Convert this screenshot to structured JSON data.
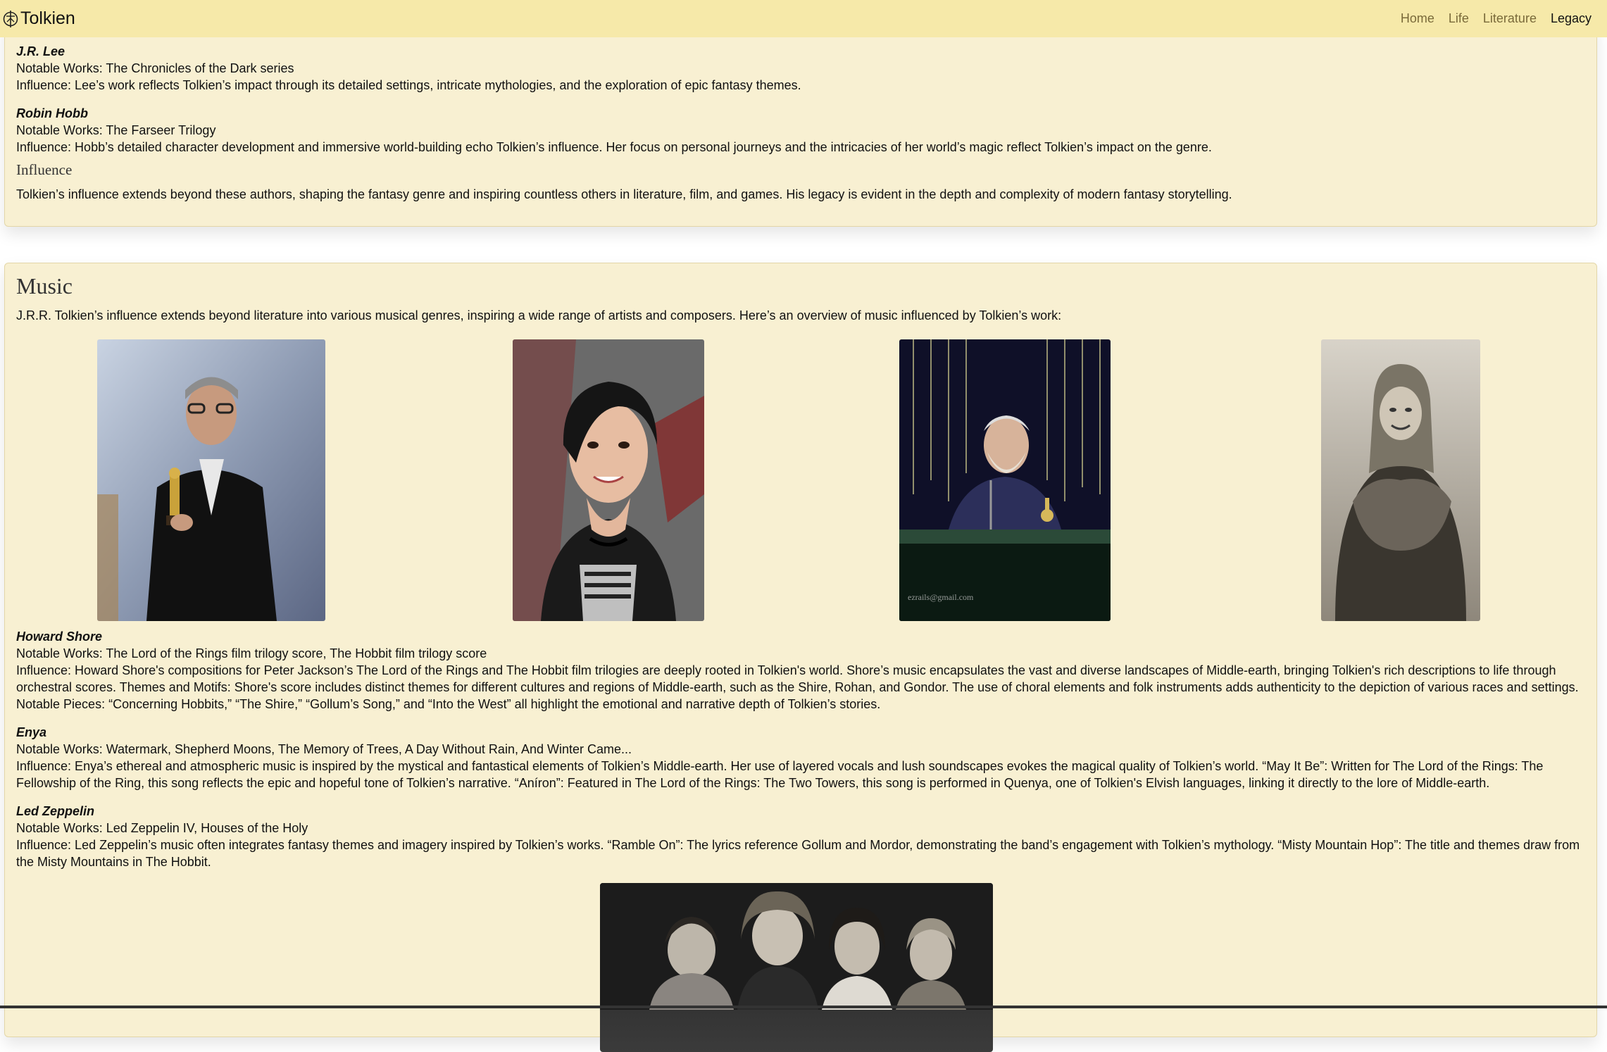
{
  "navbar": {
    "brand": "Tolkien",
    "items": [
      {
        "label": "Home",
        "active": false
      },
      {
        "label": "Life",
        "active": false
      },
      {
        "label": "Literature",
        "active": false
      },
      {
        "label": "Legacy",
        "active": true
      }
    ]
  },
  "authors": [
    {
      "name": "J.R. Lee",
      "works": "Notable Works: The Chronicles of the Dark series",
      "influence": "Influence: Lee’s work reflects Tolkien’s impact through its detailed settings, intricate mythologies, and the exploration of epic fantasy themes."
    },
    {
      "name": "Robin Hobb",
      "works": "Notable Works: The Farseer Trilogy",
      "influence": "Influence: Hobb’s detailed character development and immersive world-building echo Tolkien’s influence. Her focus on personal journeys and the intricacies of her world’s magic reflect Tolkien’s impact on the genre."
    }
  ],
  "influence": {
    "heading": "Influence",
    "text": "Tolkien’s influence extends beyond these authors, shaping the fantasy genre and inspiring countless others in literature, film, and games. His legacy is evident in the depth and complexity of modern fantasy storytelling."
  },
  "music": {
    "title": "Music",
    "intro": "J.R.R. Tolkien’s influence extends beyond literature into various musical genres, inspiring a wide range of artists and composers. Here’s an overview of music influenced by Tolkien’s work:",
    "artists": [
      {
        "name": "Howard Shore",
        "works": "Notable Works: The Lord of the Rings film trilogy score, The Hobbit film trilogy score",
        "influence": "Influence: Howard Shore's compositions for Peter Jackson’s The Lord of the Rings and The Hobbit film trilogies are deeply rooted in Tolkien's world. Shore’s music encapsulates the vast and diverse landscapes of Middle-earth, bringing Tolkien's rich descriptions to life through orchestral scores. Themes and Motifs: Shore's score includes distinct themes for different cultures and regions of Middle-earth, such as the Shire, Rohan, and Gondor. The use of choral elements and folk instruments adds authenticity to the depiction of various races and settings. Notable Pieces: “Concerning Hobbits,” “The Shire,” “Gollum’s Song,” and “Into the West” all highlight the emotional and narrative depth of Tolkien’s stories."
      },
      {
        "name": "Enya",
        "works": "Notable Works: Watermark, Shepherd Moons, The Memory of Trees, A Day Without Rain, And Winter Came...",
        "influence": "Influence: Enya’s ethereal and atmospheric music is inspired by the mystical and fantastical elements of Tolkien’s Middle-earth. Her use of layered vocals and lush soundscapes evokes the magical quality of Tolkien’s world. “May It Be”: Written for The Lord of the Rings: The Fellowship of the Ring, this song reflects the epic and hopeful tone of Tolkien’s narrative. “Aníron”: Featured in The Lord of the Rings: The Two Towers, this song is performed in Quenya, one of Tolkien's Elvish languages, linking it directly to the lore of Middle-earth."
      },
      {
        "name": "Led Zeppelin",
        "works": "Notable Works: Led Zeppelin IV, Houses of the Holy",
        "influence": "Influence: Led Zeppelin’s music often integrates fantasy themes and imagery inspired by Tolkien’s works. “Ramble On”: The lyrics reference Gollum and Mordor, demonstrating the band’s engagement with Tolkien’s mythology. “Misty Mountain Hop”: The title and themes draw from the Misty Mountains in The Hobbit."
      }
    ],
    "photo_watermark": "ezrails@gmail.com"
  }
}
